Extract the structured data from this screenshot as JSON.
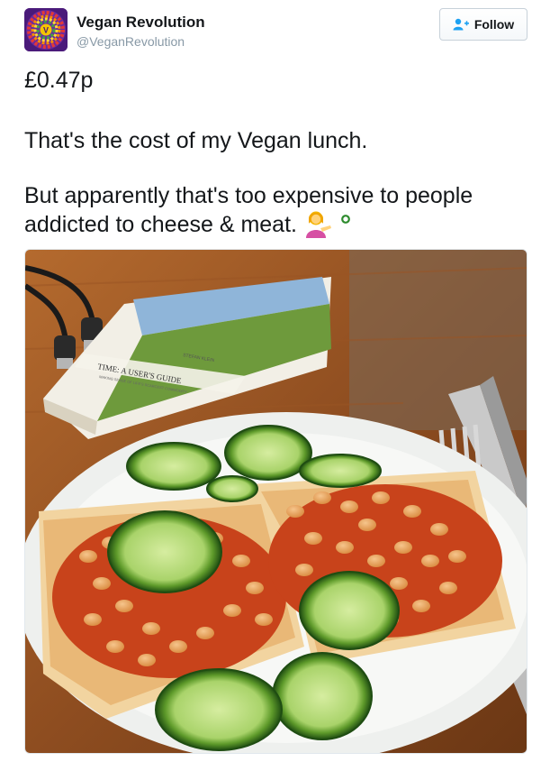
{
  "tweet": {
    "display_name": "Vegan Revolution",
    "handle": "@VeganRevolution",
    "follow_label": "Follow",
    "avatar_letter": "V",
    "price_line": "£0.47p",
    "line_1": "That's the cost of my Vegan lunch.",
    "line_2": "But apparently that's too expensive to people",
    "line_3": "addicted to cheese & meat.",
    "emoji": "person-tipping-hand-emoji",
    "photo": {
      "book_title": "TIME: A USER'S GUIDE",
      "book_author": "STEFAN KLEIN",
      "book_subtitle": "MAKING SENSE OF LIFE'S SCARCEST COMMODITY"
    }
  },
  "colors": {
    "link_blue": "#1da1f2",
    "text": "#14171a",
    "muted": "#8899a6",
    "border": "#e1e8ed"
  }
}
